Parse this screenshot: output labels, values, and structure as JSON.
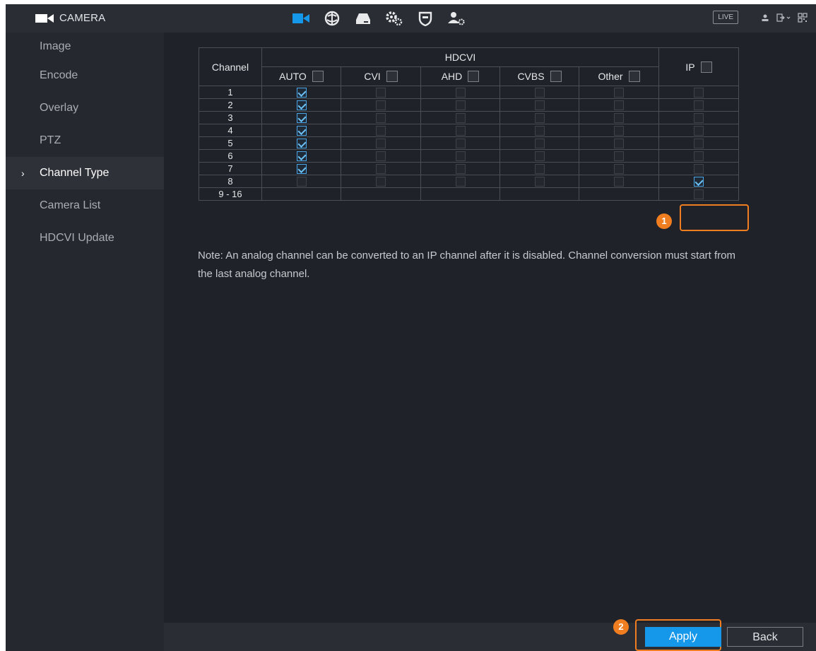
{
  "header": {
    "title": "CAMERA",
    "nav_icons": [
      "camera-icon",
      "network-icon",
      "storage-icon",
      "system-icon",
      "security-icon",
      "account-icon"
    ],
    "live_label": "LIVE",
    "tool_icons": [
      "user-icon",
      "logout-icon",
      "qr-code-icon"
    ]
  },
  "sidebar": {
    "items": [
      {
        "label": "Image"
      },
      {
        "label": "Encode"
      },
      {
        "label": "Overlay"
      },
      {
        "label": "PTZ"
      },
      {
        "label": "Channel Type",
        "active": true
      },
      {
        "label": "Camera List"
      },
      {
        "label": "HDCVI Update"
      }
    ]
  },
  "table": {
    "channel_header": "Channel",
    "group_header": "HDCVI",
    "columns": [
      "AUTO",
      "CVI",
      "AHD",
      "CVBS",
      "Other"
    ],
    "ip_header": "IP",
    "rows": [
      {
        "channel": "1",
        "auto": true,
        "ip": false
      },
      {
        "channel": "2",
        "auto": true,
        "ip": false
      },
      {
        "channel": "3",
        "auto": true,
        "ip": false
      },
      {
        "channel": "4",
        "auto": true,
        "ip": false
      },
      {
        "channel": "5",
        "auto": true,
        "ip": false
      },
      {
        "channel": "6",
        "auto": true,
        "ip": false
      },
      {
        "channel": "7",
        "auto": true,
        "ip": false
      },
      {
        "channel": "8",
        "auto": false,
        "ip": true
      },
      {
        "channel": "9 - 16",
        "auto": null,
        "ip": false
      }
    ]
  },
  "note": "Note: An analog channel can be converted to an IP channel after it is disabled. Channel conversion must start from the last analog channel.",
  "markers": {
    "one": "1",
    "two": "2"
  },
  "buttons": {
    "apply": "Apply",
    "back": "Back"
  },
  "colors": {
    "accent": "#1597ea",
    "highlight": "#f07d1f",
    "background": "#1f2228"
  }
}
